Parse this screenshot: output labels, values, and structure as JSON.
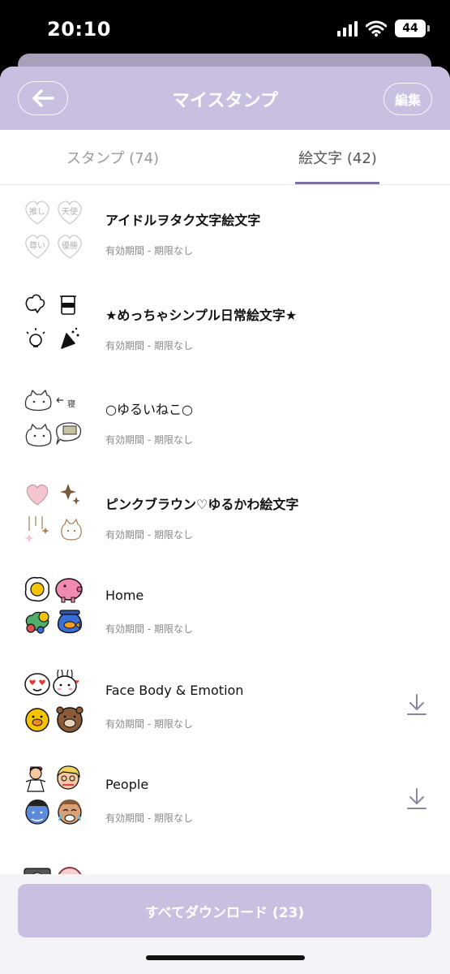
{
  "status": {
    "time": "20:10",
    "battery": "44"
  },
  "header": {
    "title": "マイスタンプ",
    "edit_label": "編集"
  },
  "tabs": [
    {
      "label": "スタンプ (74)",
      "selected": false
    },
    {
      "label": "絵文字 (42)",
      "selected": true
    }
  ],
  "items": [
    {
      "name": "アイドルヲタク文字絵文字",
      "subtitle": "有効期間 - 期限なし",
      "downloadable": false,
      "thumb_icon": "idol-heart-emoji-thumb",
      "thumb_texts": [
        "推し",
        "天使",
        "尊い",
        "優勝"
      ]
    },
    {
      "name": "★めっちゃシンプル日常絵文字★",
      "subtitle": "有効期間 - 期限なし",
      "downloadable": false,
      "thumb_icon": "simple-daily-emoji-thumb"
    },
    {
      "name": "○ゆるいねこ○",
      "subtitle": "有効期間 - 期限なし",
      "downloadable": false,
      "thumb_icon": "cat-emoji-thumb"
    },
    {
      "name": "ピンクブラウン♡ゆるかわ絵文字",
      "subtitle": "有効期間 - 期限なし",
      "downloadable": false,
      "thumb_icon": "pink-brown-emoji-thumb"
    },
    {
      "name": "Home",
      "subtitle": "有効期間 - 期限なし",
      "downloadable": false,
      "thumb_icon": "home-emoji-thumb"
    },
    {
      "name": "Face Body & Emotion",
      "subtitle": "有効期間 - 期限なし",
      "downloadable": true,
      "thumb_icon": "face-emoji-thumb"
    },
    {
      "name": "People",
      "subtitle": "有効期間 - 期限なし",
      "downloadable": true,
      "thumb_icon": "people-emoji-thumb"
    }
  ],
  "footer": {
    "download_all_label": "すべてダウンロード (23)"
  },
  "colors": {
    "accent": "#c9bfe0",
    "tab_indicator": "#7b70a0",
    "subtitle": "#888888"
  }
}
